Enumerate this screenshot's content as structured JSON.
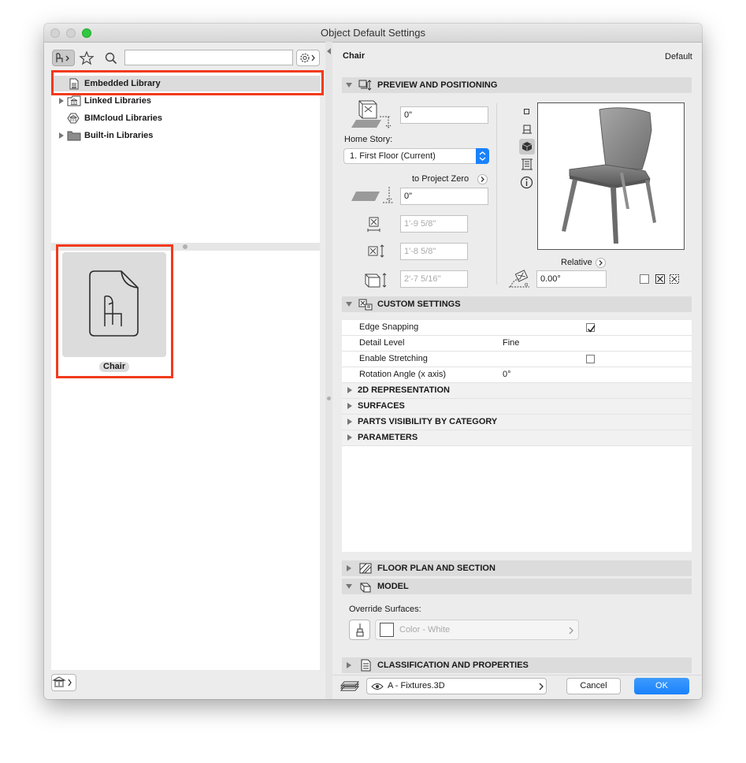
{
  "window": {
    "title": "Object Default Settings"
  },
  "library": {
    "search_placeholder": "",
    "tree": [
      {
        "label": "Embedded Library"
      },
      {
        "label": "Linked Libraries"
      },
      {
        "label": "BIMcloud Libraries"
      },
      {
        "label": "Built-in Libraries"
      }
    ],
    "object_label": "Chair"
  },
  "header": {
    "object_name": "Chair",
    "default_label": "Default"
  },
  "preview": {
    "section_title": "PREVIEW AND POSITIONING",
    "elevation_value": "0\"",
    "home_story_label": "Home Story:",
    "home_story_value": "1. First Floor (Current)",
    "to_project_zero_label": "to Project Zero",
    "project_zero_value": "0\"",
    "dim_width": "1'-9 5/8\"",
    "dim_depth": "1'-8 5/8\"",
    "dim_height": "2'-7 5/16\"",
    "relative_label": "Relative",
    "rotation_value": "0.00°"
  },
  "custom": {
    "section_title": "CUSTOM SETTINGS",
    "rows": [
      {
        "label": "Edge Snapping",
        "value": "",
        "checked": true
      },
      {
        "label": "Detail Level",
        "value": "Fine"
      },
      {
        "label": "Enable Stretching",
        "value": "",
        "checked": false
      },
      {
        "label": "Rotation Angle (x axis)",
        "value": "0°"
      }
    ],
    "subsections": [
      "2D REPRESENTATION",
      "SURFACES",
      "PARTS VISIBILITY BY CATEGORY",
      "PARAMETERS"
    ]
  },
  "floor_plan": {
    "section_title": "FLOOR PLAN AND SECTION"
  },
  "model": {
    "section_title": "MODEL",
    "override_label": "Override Surfaces:",
    "surface_value": "Color - White"
  },
  "classification": {
    "section_title": "CLASSIFICATION AND PROPERTIES"
  },
  "footer": {
    "layer_value": "A - Fixtures.3D",
    "cancel_label": "Cancel",
    "ok_label": "OK"
  },
  "colors": {
    "accent": "#1a82fb",
    "highlight": "#f23a1c",
    "section_bg": "#dcdcdc"
  }
}
